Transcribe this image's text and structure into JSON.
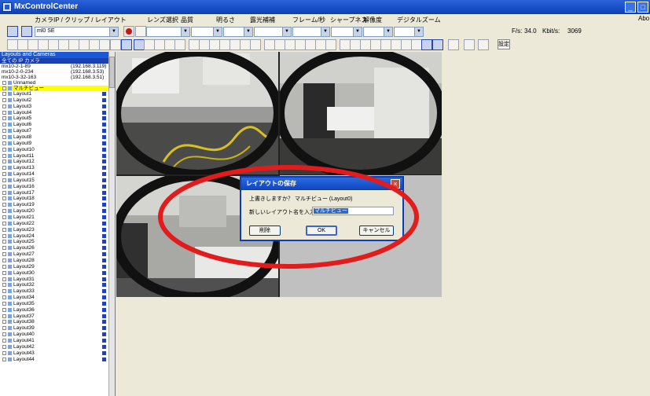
{
  "window": {
    "title": "MxControlCenter",
    "about": "Abo"
  },
  "menu_labels": [
    "カメラIP / クリップ / レイアウト",
    "レンズ選択",
    "品質",
    "明るさ",
    "露光補補",
    "フレーム/秒",
    "シャープネス",
    "解像度",
    "デジタルズーム"
  ],
  "toolbar": {
    "camera_select_value": "ml0 SE",
    "fps_label": "F/s:",
    "fps_value": "34.0",
    "kbps_label": "Kbit/s:",
    "kbps_value": "3069",
    "settings_label": "設定"
  },
  "panel": {
    "header": "Layouts and Cameras",
    "group_label": "全ての IP カメラ",
    "cameras": [
      {
        "name": "mx10-2-1-89",
        "ip": "(192.168.3.119)"
      },
      {
        "name": "mx10-2-0-234",
        "ip": "(192.168.3.53)"
      },
      {
        "name": "mx10-3-32-163",
        "ip": "(192.168.3.51)"
      }
    ],
    "unnamed": "Unnamed",
    "selected_item": "マルチビュー",
    "layouts": [
      "Layout1",
      "Layout2",
      "Layout3",
      "Layout4",
      "Layout5",
      "Layout6",
      "Layout7",
      "Layout8",
      "Layout9",
      "Layout10",
      "Layout11",
      "Layout12",
      "Layout13",
      "Layout14",
      "Layout15",
      "Layout16",
      "Layout17",
      "Layout18",
      "Layout19",
      "Layout20",
      "Layout21",
      "Layout22",
      "Layout23",
      "Layout24",
      "Layout25",
      "Layout26",
      "Layout27",
      "Layout28",
      "Layout29",
      "Layout30",
      "Layout31",
      "Layout32",
      "Layout33",
      "Layout34",
      "Layout35",
      "Layout36",
      "Layout37",
      "Layout38",
      "Layout39",
      "Layout40",
      "Layout41",
      "Layout42",
      "Layout43",
      "Layout44"
    ]
  },
  "dialog": {
    "title": "レイアウトの保存",
    "question": "上書きしますか？ マルチビュー (Layout0)",
    "name_label": "新しいレイアウト名を入力：",
    "name_value": "マルチビュー",
    "delete_label": "削除",
    "ok_label": "OK",
    "cancel_label": "キャンセル"
  },
  "colors": {
    "title_bar": "#0a3fb8",
    "panel_header": "#1a58d8",
    "selection": "#ffff00",
    "annotation": "#e21c1c"
  }
}
